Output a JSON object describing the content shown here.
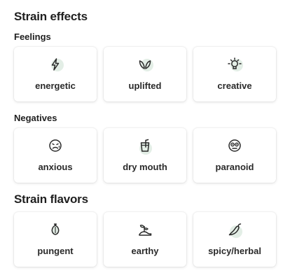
{
  "effects": {
    "title": "Strain effects",
    "feelings": {
      "heading": "Feelings",
      "items": [
        {
          "label": "energetic",
          "icon": "lightning-icon"
        },
        {
          "label": "uplifted",
          "icon": "sprout-icon"
        },
        {
          "label": "creative",
          "icon": "lightbulb-icon"
        }
      ]
    },
    "negatives": {
      "heading": "Negatives",
      "items": [
        {
          "label": "anxious",
          "icon": "anxious-face-icon"
        },
        {
          "label": "dry mouth",
          "icon": "glass-with-straw-icon"
        },
        {
          "label": "paranoid",
          "icon": "paranoid-face-icon"
        }
      ]
    }
  },
  "flavors": {
    "title": "Strain flavors",
    "items": [
      {
        "label": "pungent",
        "icon": "onion-icon"
      },
      {
        "label": "earthy",
        "icon": "plant-in-soil-icon"
      },
      {
        "label": "spicy/herbal",
        "icon": "chili-pepper-icon"
      }
    ]
  },
  "colors": {
    "icon_accent": "#e3eee6",
    "text": "#1f1f1f"
  }
}
